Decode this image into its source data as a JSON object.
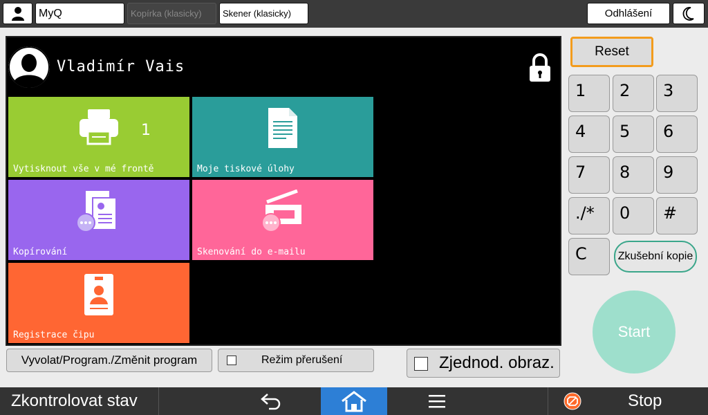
{
  "topbar": {
    "user_icon": "user-icon",
    "myq_label": "MyQ",
    "copier_label": "Kopírka (klasicky)",
    "scanner_label": "Skener (klasicky)",
    "logout_label": "Odhlášení",
    "moon_icon": "moon-icon"
  },
  "panel": {
    "username": "Vladimír Vais",
    "lock_icon": "lock-icon",
    "tiles": [
      {
        "label": "Vytisknout vše v mé frontě",
        "count": "1",
        "color": "#99cc33",
        "icon": "printer-icon"
      },
      {
        "label": "Moje tiskové úlohy",
        "color": "#2a9d9a",
        "icon": "document-icon"
      },
      {
        "label": "Kopírování",
        "color": "#9966ee",
        "icon": "copy-icon"
      },
      {
        "label": "Skenování do e-mailu",
        "color": "#ff6699",
        "icon": "scanner-icon"
      },
      {
        "label": "Registrace čipu",
        "color": "#ff6633",
        "icon": "id-card-icon"
      }
    ]
  },
  "actions": {
    "recall_label": "Vyvolat/Program./Změnit program",
    "interrupt_label": "Režim přerušení",
    "simple_label": "Zjednod. obraz."
  },
  "keypad": {
    "reset_label": "Reset",
    "keys": [
      "1",
      "2",
      "3",
      "4",
      "5",
      "6",
      "7",
      "8",
      "9",
      "./*",
      "0",
      "#",
      "C"
    ],
    "trial_label": "Zkušební kopie",
    "start_label": "Start"
  },
  "bottombar": {
    "status_label": "Zkontrolovat stav",
    "stop_label": "Stop"
  },
  "colors": {
    "reset_border": "#f39c1d",
    "home_active": "#2d7fd6",
    "start": "#9edfcc",
    "trial_border": "#3aa68a"
  }
}
